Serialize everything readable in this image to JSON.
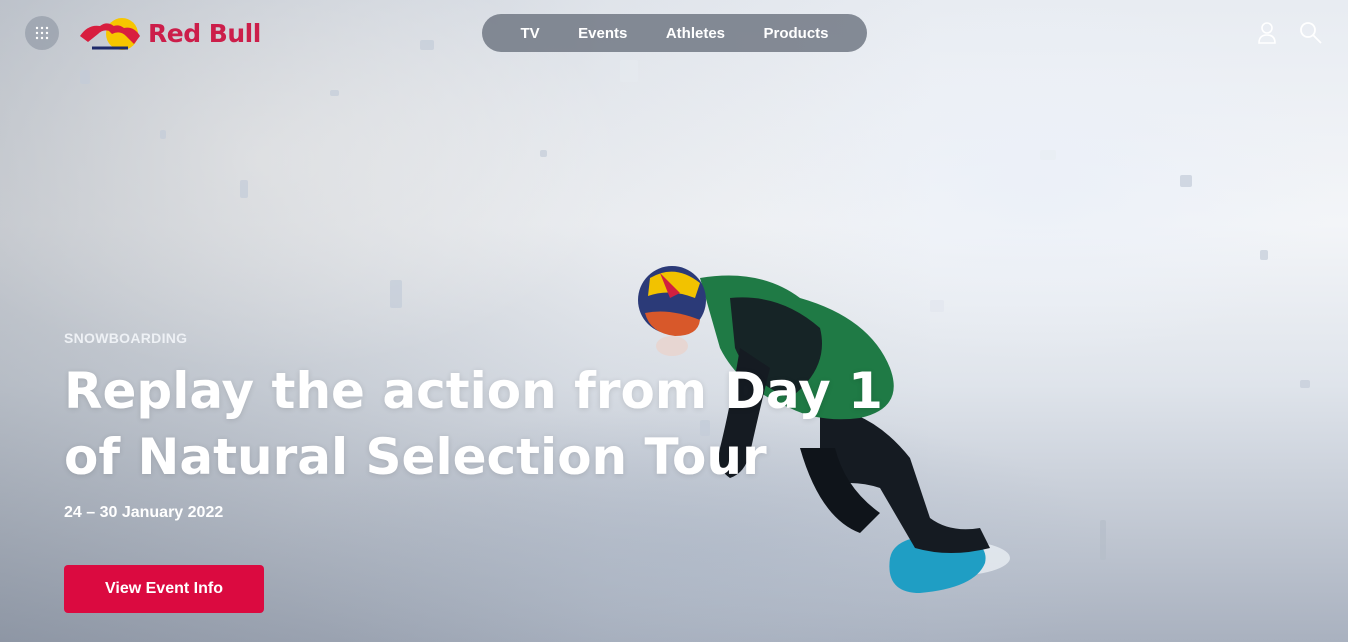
{
  "header": {
    "apps_icon": "grid-icon",
    "logo_text": "Red Bull",
    "nav": [
      {
        "label": "TV"
      },
      {
        "label": "Events"
      },
      {
        "label": "Athletes"
      },
      {
        "label": "Products"
      }
    ],
    "account_icon": "user-icon",
    "search_icon": "search-icon"
  },
  "hero": {
    "category": "SNOWBOARDING",
    "headline": "Replay the action from Day 1 of Natural Selection Tour",
    "dates": "24 – 30 January 2022",
    "cta_label": "View Event Info"
  },
  "colors": {
    "brand_red": "#cc1e4a",
    "cta_red": "#db0a40",
    "nav_pill": "#6c7480",
    "jacket_green": "#1f7a45",
    "board_blue": "#1f9ec4"
  }
}
